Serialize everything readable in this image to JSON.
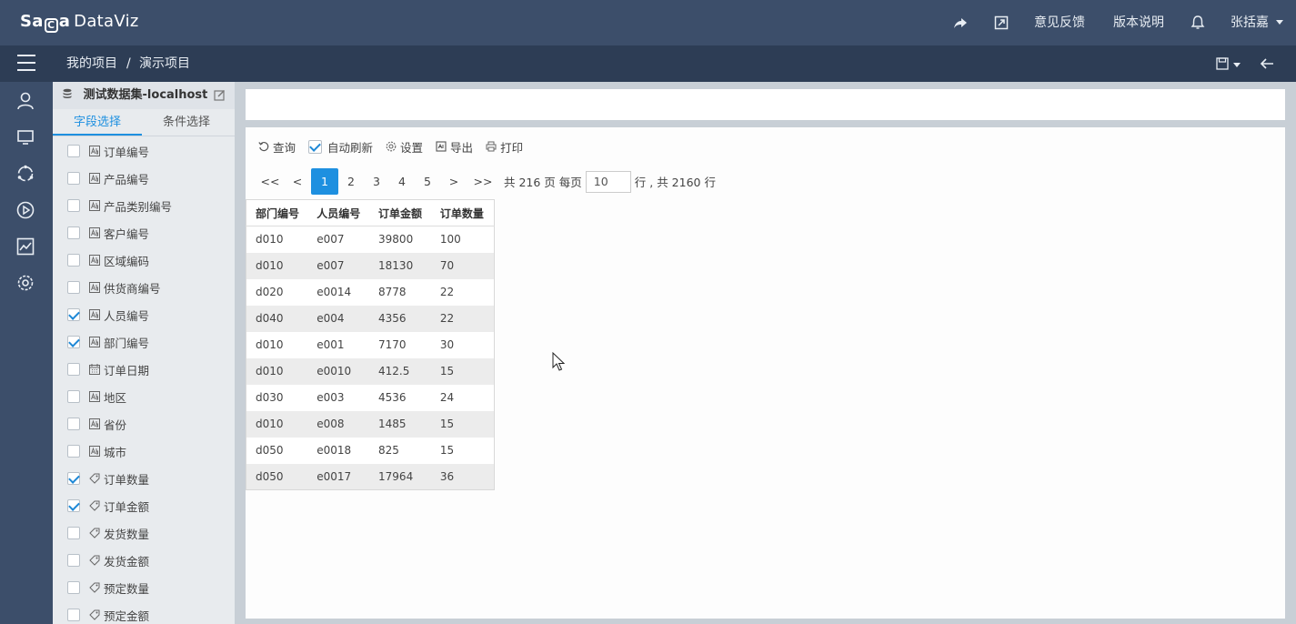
{
  "app": {
    "logo_brand_a": "Sa",
    "logo_brand_mark": "C",
    "logo_brand_b": "a",
    "logo_product": "DataViz",
    "feedback": "意见反馈",
    "release_notes": "版本说明",
    "user": "张括嘉"
  },
  "breadcrumb": {
    "root": "我的项目",
    "sep": "/",
    "current": "演示项目"
  },
  "dataset": {
    "name": "测试数据集-localhost"
  },
  "tabs": [
    {
      "label": "字段选择"
    },
    {
      "label": "条件选择"
    }
  ],
  "fields": [
    {
      "label": "订单编号",
      "checked": false,
      "type": "text-icon"
    },
    {
      "label": "产品编号",
      "checked": false,
      "type": "text-icon"
    },
    {
      "label": "产品类别编号",
      "checked": false,
      "type": "text-icon"
    },
    {
      "label": "客户编号",
      "checked": false,
      "type": "text-icon"
    },
    {
      "label": "区域编码",
      "checked": false,
      "type": "text-icon"
    },
    {
      "label": "供货商编号",
      "checked": false,
      "type": "text-icon"
    },
    {
      "label": "人员编号",
      "checked": true,
      "type": "text-icon"
    },
    {
      "label": "部门编号",
      "checked": true,
      "type": "text-icon"
    },
    {
      "label": "订单日期",
      "checked": false,
      "type": "calendar-icon"
    },
    {
      "label": "地区",
      "checked": false,
      "type": "text-icon"
    },
    {
      "label": "省份",
      "checked": false,
      "type": "text-icon"
    },
    {
      "label": "城市",
      "checked": false,
      "type": "text-icon"
    },
    {
      "label": "订单数量",
      "checked": true,
      "type": "tag-icon"
    },
    {
      "label": "订单金额",
      "checked": true,
      "type": "tag-icon"
    },
    {
      "label": "发货数量",
      "checked": false,
      "type": "tag-icon"
    },
    {
      "label": "发货金额",
      "checked": false,
      "type": "tag-icon"
    },
    {
      "label": "预定数量",
      "checked": false,
      "type": "tag-icon"
    },
    {
      "label": "预定金额",
      "checked": false,
      "type": "tag-icon"
    }
  ],
  "toolbar": {
    "query": "查询",
    "auto_refresh": "自动刷新",
    "settings": "设置",
    "export": "导出",
    "print": "打印"
  },
  "pager": {
    "first": "<<",
    "prev": "<",
    "pages": [
      "1",
      "2",
      "3",
      "4",
      "5"
    ],
    "next": ">",
    "last": ">>",
    "total_pages_text": "共 216 页 每页",
    "page_size": "10",
    "total_rows_text": "行 , 共 2160 行"
  },
  "table": {
    "headers": [
      "部门编号",
      "人员编号",
      "订单金额",
      "订单数量"
    ],
    "rows": [
      [
        "d010",
        "e007",
        "39800",
        "100"
      ],
      [
        "d010",
        "e007",
        "18130",
        "70"
      ],
      [
        "d020",
        "e0014",
        "8778",
        "22"
      ],
      [
        "d040",
        "e004",
        "4356",
        "22"
      ],
      [
        "d010",
        "e001",
        "7170",
        "30"
      ],
      [
        "d010",
        "e0010",
        "412.5",
        "15"
      ],
      [
        "d030",
        "e003",
        "4536",
        "24"
      ],
      [
        "d010",
        "e008",
        "1485",
        "15"
      ],
      [
        "d050",
        "e0018",
        "825",
        "15"
      ],
      [
        "d050",
        "e0017",
        "17964",
        "36"
      ]
    ]
  },
  "colors": {
    "topbar": "#3c4e6a",
    "crumbbar": "#2d3d55",
    "accent": "#1e90e0"
  }
}
